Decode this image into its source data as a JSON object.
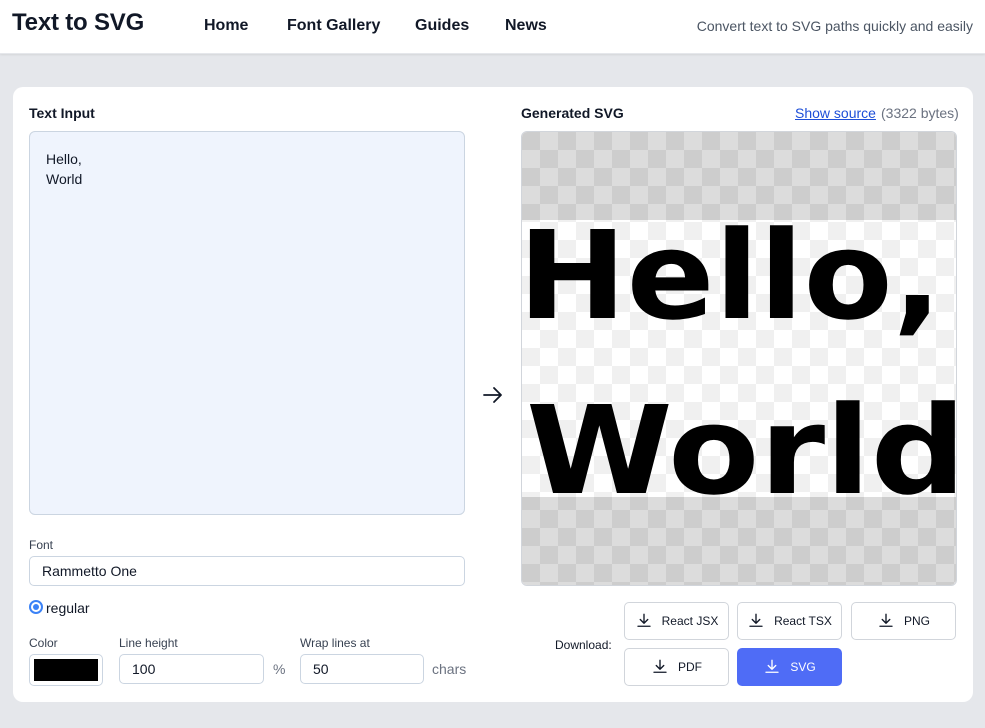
{
  "header": {
    "brand": "Text to SVG",
    "nav": [
      "Home",
      "Font Gallery",
      "Guides",
      "News"
    ],
    "tagline": "Convert text to SVG paths quickly and easily"
  },
  "input": {
    "label": "Text Input",
    "value": "Hello,\nWorld"
  },
  "output": {
    "label": "Generated SVG",
    "show_source": "Show source",
    "bytes": "(3322 bytes)",
    "preview_lines": [
      "Hello,",
      "World"
    ]
  },
  "font": {
    "label": "Font",
    "value": "Rammetto One",
    "variant": "regular"
  },
  "settings": {
    "color_label": "Color",
    "color_value": "#000000",
    "line_height_label": "Line height",
    "line_height_value": "100",
    "line_height_unit": "%",
    "wrap_label": "Wrap lines at",
    "wrap_value": "50",
    "wrap_unit": "chars"
  },
  "download": {
    "label": "Download:",
    "buttons": [
      "React JSX",
      "React TSX",
      "PNG",
      "PDF",
      "SVG"
    ]
  },
  "icons": {
    "arrow": "arrow-right-icon",
    "download": "download-icon"
  },
  "colors": {
    "accent": "#4f6cf6",
    "link": "#1d4ed8",
    "textarea_bg": "#eff4fd"
  }
}
